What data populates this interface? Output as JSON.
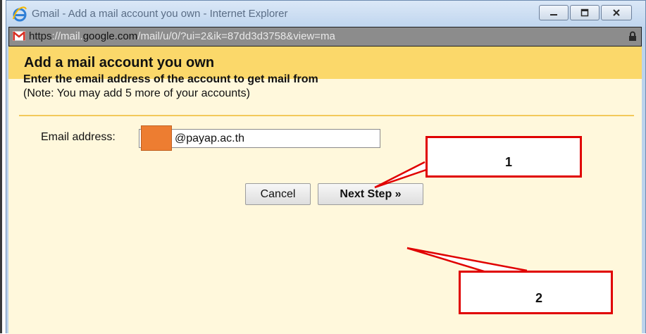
{
  "window": {
    "title": "Gmail - Add a mail account you own - Internet Explorer",
    "url_proto": "https",
    "url_rest_1": "://mail.",
    "url_domain": "google.com",
    "url_rest_2": "/mail/u/0/?ui=2&ik=87dd3d3758&view=ma"
  },
  "dialog": {
    "title": "Add a mail account you own",
    "instruction": "Enter the email address of the account to get mail from",
    "note": "(Note: You may add 5 more of your accounts)",
    "email_label": "Email address:",
    "email_value": "@payap.ac.th",
    "cancel_label": "Cancel",
    "next_label": "Next Step »"
  },
  "annotations": {
    "callout_1": "1",
    "callout_2": "2"
  },
  "colors": {
    "header": "#fbd86a",
    "body": "#fff8dc",
    "callout": "#e00000",
    "redaction": "#ed7d31"
  }
}
